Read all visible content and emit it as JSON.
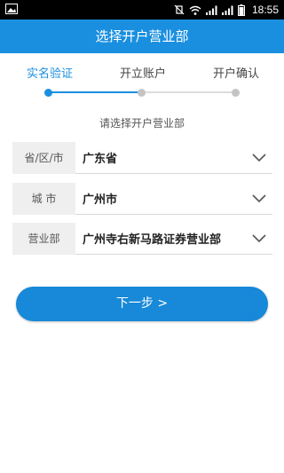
{
  "status_bar": {
    "time": "18:55"
  },
  "header": {
    "title": "选择开户营业部"
  },
  "steps": [
    {
      "label": "实名验证"
    },
    {
      "label": "开立账户"
    },
    {
      "label": "开户确认"
    }
  ],
  "prompt": "请选择开户营业部",
  "fields": [
    {
      "label": "省/区/市",
      "value": "广东省"
    },
    {
      "label": "城 市",
      "value": "广州市"
    },
    {
      "label": "营业部",
      "value": "广州寺右新马路证券营业部"
    }
  ],
  "next_button": "下一步 >",
  "colors": {
    "accent": "#1a8fe0",
    "button": "#1789d8",
    "inactive": "#c4c4c4"
  }
}
